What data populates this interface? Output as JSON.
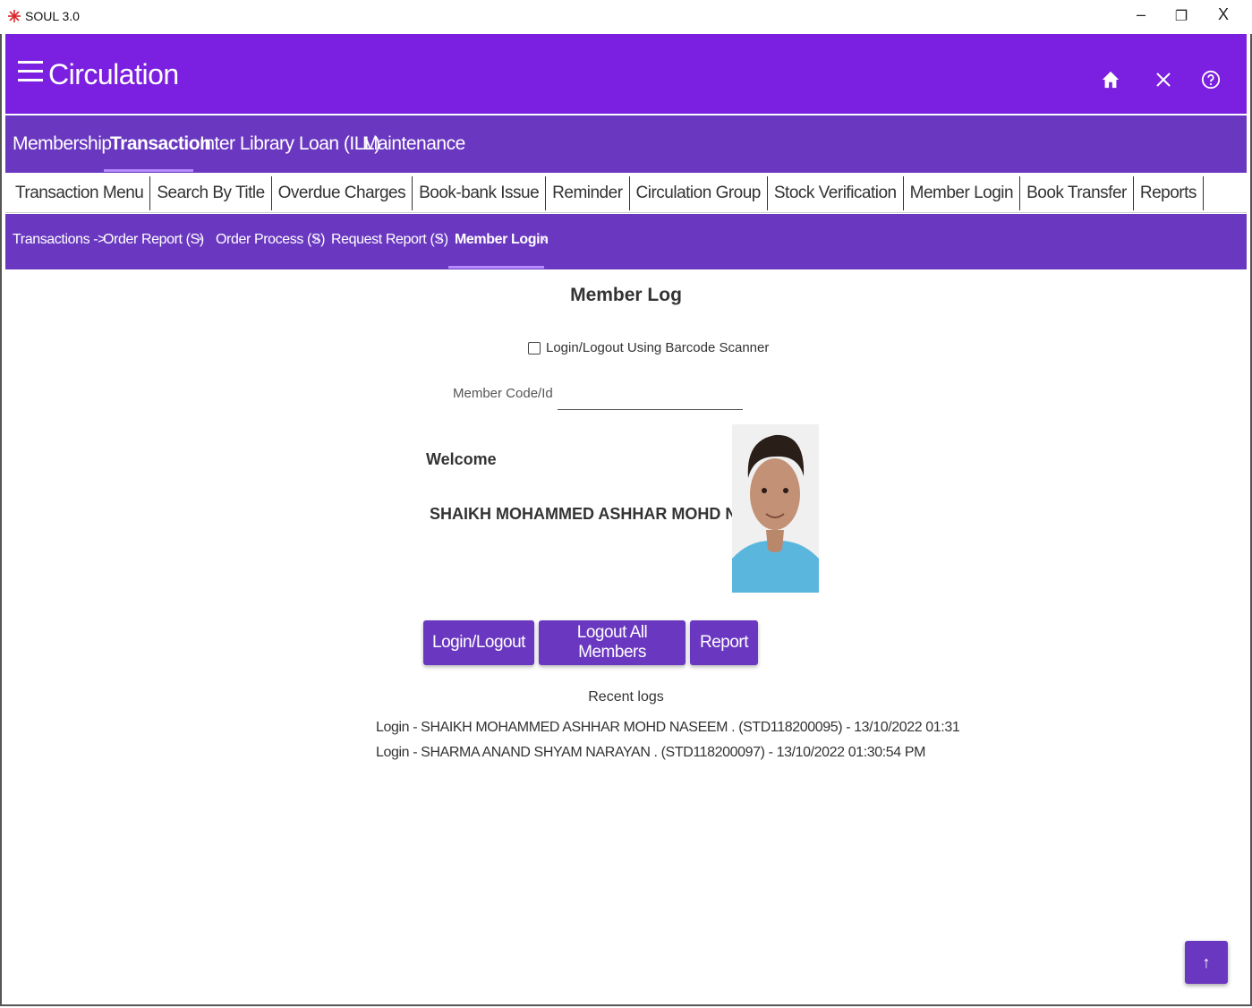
{
  "window": {
    "title": "SOUL 3.0",
    "minimize_glyph": "–",
    "restore_glyph": "❐",
    "close_glyph": "X"
  },
  "appbar": {
    "title": "Circulation",
    "icons": [
      "home-icon",
      "close-icon",
      "help-icon"
    ]
  },
  "module_nav": {
    "items": [
      "Membership",
      "Transaction",
      "Inter Library Loan (ILL)",
      "Maintenance"
    ],
    "active": "Transaction"
  },
  "sub_nav": {
    "tabs": [
      "Transaction Menu",
      "Search By Title",
      "Overdue Charges",
      "Book-bank Issue",
      "Reminder",
      "Circulation Group",
      "Stock Verification",
      "Member Login",
      "Book Transfer",
      "Reports"
    ]
  },
  "breadcrumb": {
    "root": "Transactions ->",
    "items": [
      "Order Report (S)",
      "Order Process (S)",
      "Request Report (S)",
      "Member Login"
    ],
    "close_glyph": "×",
    "active": "Member Login"
  },
  "main": {
    "heading": "Member Log",
    "barcode_checkbox_label": "Login/Logout Using Barcode Scanner",
    "barcode_checked": false,
    "member_code_label": "Member Code/Id",
    "member_code_value": "",
    "welcome": "Welcome",
    "member_name": "SHAIKH MOHAMMED ASHHAR MOHD NASEEM",
    "buttons": {
      "login_logout": "Login/Logout",
      "logout_all": "Logout All Members",
      "report": "Report"
    },
    "recent_logs_title": "Recent logs",
    "logs": [
      "Login  -  SHAIKH MOHAMMED ASHHAR MOHD NASEEM . (STD118200095)  -  13/10/2022 01:31",
      "Login  -  SHARMA ANAND SHYAM NARAYAN . (STD118200097)  -  13/10/2022 01:30:54 PM"
    ]
  },
  "fab": {
    "glyph": "↑"
  },
  "colors": {
    "primary": "#7b1fe0",
    "nav": "#6a38c0",
    "button": "#6a38c0"
  }
}
